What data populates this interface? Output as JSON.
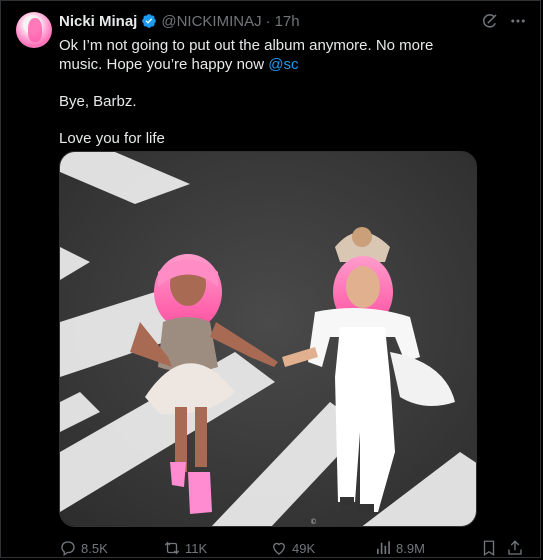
{
  "post": {
    "author_name": "Nicki Minaj",
    "handle": "@NICKIMINAJ",
    "separator": "·",
    "time": "17h",
    "line1": "Ok I’m not going to put out the album anymore. No more music. Hope you’re happy now",
    "mention": "@sc",
    "line2": "Bye, Barbz.",
    "line3": "Love you for life"
  },
  "stats": {
    "replies": "8.5K",
    "reposts": "11K",
    "likes": "49K",
    "views": "8.9M"
  },
  "icons": {
    "verified": "verified-badge-icon",
    "grok": "grok-icon",
    "more": "more-icon",
    "reply": "reply-icon",
    "repost": "repost-icon",
    "like": "like-icon",
    "views": "views-icon",
    "bookmark": "bookmark-icon",
    "share": "share-icon"
  },
  "colors": {
    "background": "#000000",
    "text": "#e7e9ea",
    "muted": "#71767b",
    "accent": "#1d9bf0"
  }
}
